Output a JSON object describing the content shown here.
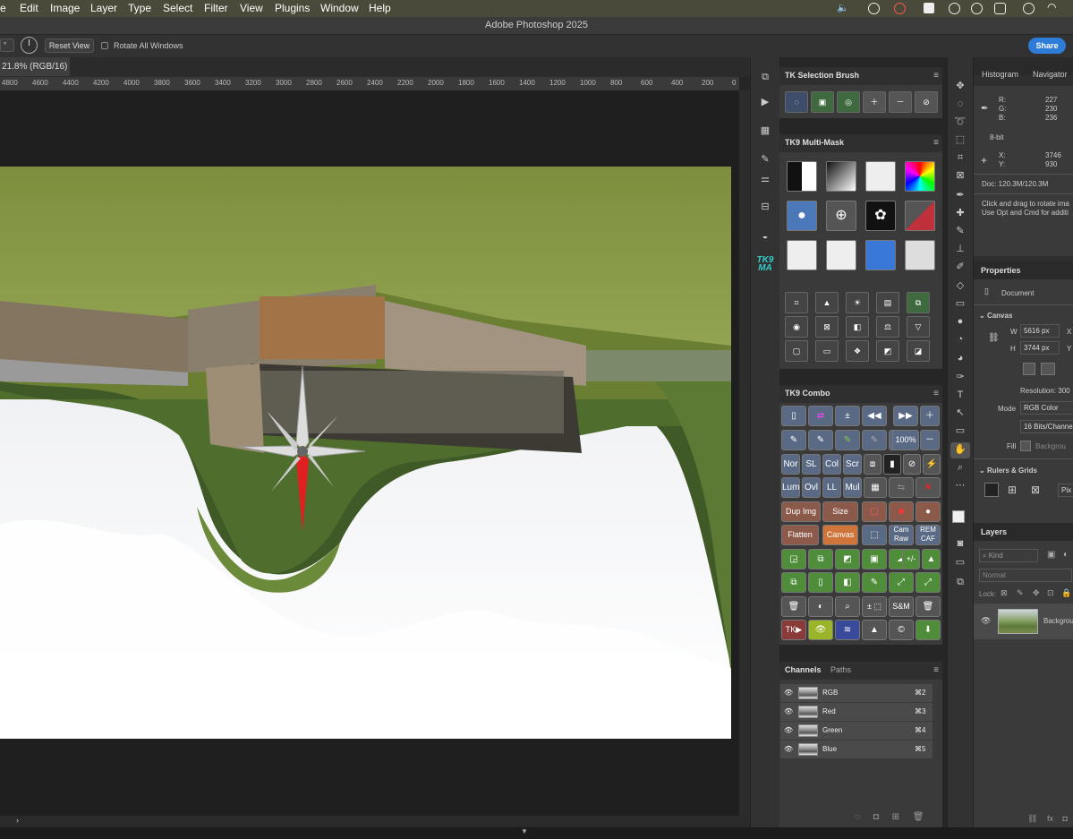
{
  "menubar": {
    "items": [
      "e",
      "Edit",
      "Image",
      "Layer",
      "Type",
      "Select",
      "Filter",
      "View",
      "Plugins",
      "Window",
      "Help"
    ]
  },
  "title": "Adobe Photoshop 2025",
  "options": {
    "field_value": "°",
    "reset_view": "Reset View",
    "rotate_all": "Rotate All Windows",
    "share": "Share"
  },
  "doc_tab": "21.8% (RGB/16)",
  "ruler": [
    "4800",
    "4600",
    "4400",
    "4200",
    "4000",
    "3800",
    "3600",
    "3400",
    "3200",
    "3000",
    "2800",
    "2600",
    "2400",
    "2200",
    "2000",
    "1800",
    "1600",
    "1400",
    "1200",
    "1000",
    "800",
    "600",
    "400",
    "200",
    "0"
  ],
  "tk_selection": {
    "title": "TK Selection Brush"
  },
  "tk9_multimask": {
    "title": "TK9 Multi-Mask"
  },
  "tk9_combo": {
    "title": "TK9 Combo",
    "row3": [
      "Nor",
      "SL",
      "Col",
      "Scr"
    ],
    "row4": [
      "Lum",
      "Ovl",
      "LL",
      "Mul"
    ],
    "zoom": "100%",
    "dup": "Dup Img",
    "size": "Size",
    "flatten": "Flatten",
    "canvas": "Canvas",
    "camraw": "Cam Raw",
    "remcaf": "REM CAF",
    "plusminus": "+/-",
    "sm": "S&M",
    "pm_dots": "± ⬚",
    "tk": "TK▶"
  },
  "strip_logo": "TK9 MA",
  "channels": {
    "tabs": [
      "Channels",
      "Paths"
    ],
    "rows": [
      {
        "name": "RGB",
        "key": "⌘2"
      },
      {
        "name": "Red",
        "key": "⌘3"
      },
      {
        "name": "Green",
        "key": "⌘4"
      },
      {
        "name": "Blue",
        "key": "⌘5"
      }
    ]
  },
  "info": {
    "tabs": [
      "Histogram",
      "Navigator"
    ],
    "r_label": "R:",
    "r": "227",
    "g_label": "G:",
    "g": "230",
    "b_label": "B:",
    "b": "236",
    "bit": "8-bit",
    "x_label": "X:",
    "x": "3746",
    "y_label": "Y:",
    "y": "930",
    "doc": "Doc: 120.3M/120.3M",
    "hint1": "Click and drag to rotate ima",
    "hint2": "Use Opt and Cmd for additi"
  },
  "properties": {
    "title": "Properties",
    "document": "Document",
    "canvas": "Canvas",
    "w_label": "W",
    "w": "5616 px",
    "x": "X",
    "h_label": "H",
    "h": "3744 px",
    "y": "Y",
    "resolution": "Resolution: 300",
    "mode_label": "Mode",
    "mode": "RGB Color",
    "bits": "16 Bits/Channe",
    "fill_label": "Fill",
    "fill": "Backgrou",
    "rulers": "Rulers & Grids",
    "pix": "Pix"
  },
  "layers": {
    "title": "Layers",
    "kind": "Kind",
    "blend": "Normal",
    "lock": "Lock:",
    "layer_name": "Backgrou"
  },
  "colors": {
    "accent": "#2f7bd8",
    "combo_blue": "#5a6a85",
    "combo_brown": "#8b5a4a",
    "combo_orange": "#d0753a",
    "combo_green": "#4f8d3a"
  }
}
